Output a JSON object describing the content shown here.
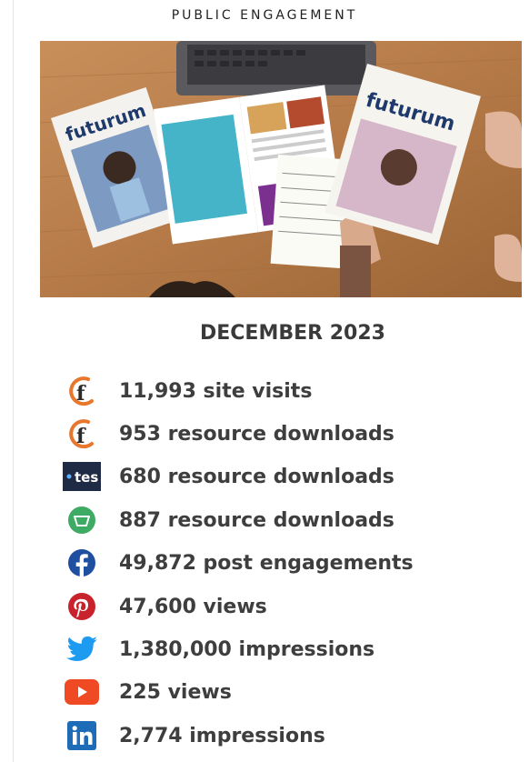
{
  "section": {
    "heading": "PUBLIC ENGAGEMENT"
  },
  "hero": {
    "alt": "Futurum magazines spread on a wooden table with a laptop and notepad",
    "magazine_wordmark": "futurum"
  },
  "period": "DECEMBER 2023",
  "stats": [
    {
      "icon": "futurum-icon",
      "text": "11,993 site visits"
    },
    {
      "icon": "futurum-icon",
      "text": "953 resource downloads"
    },
    {
      "icon": "tes-icon",
      "icon_text": "tes",
      "text": "680 resource downloads"
    },
    {
      "icon": "green-circle-icon",
      "text": "887 resource downloads"
    },
    {
      "icon": "facebook-icon",
      "text": "49,872 post engagements"
    },
    {
      "icon": "pinterest-icon",
      "text": "47,600 views"
    },
    {
      "icon": "twitter-icon",
      "text": "1,380,000 impressions"
    },
    {
      "icon": "youtube-icon",
      "text": "225 views"
    },
    {
      "icon": "linkedin-icon",
      "text": "2,774 impressions"
    }
  ],
  "colors": {
    "heading_text": "#222222",
    "body_text": "#3e3e3e",
    "futurum_orange": "#e8772e",
    "facebook_blue": "#1f4fa0",
    "pinterest_red": "#c8232c",
    "twitter_blue": "#1d9bf0",
    "youtube_red": "#ef4a23",
    "linkedin_blue": "#1e6bb8",
    "tes_navy": "#1f2a44",
    "green": "#3dab64"
  }
}
